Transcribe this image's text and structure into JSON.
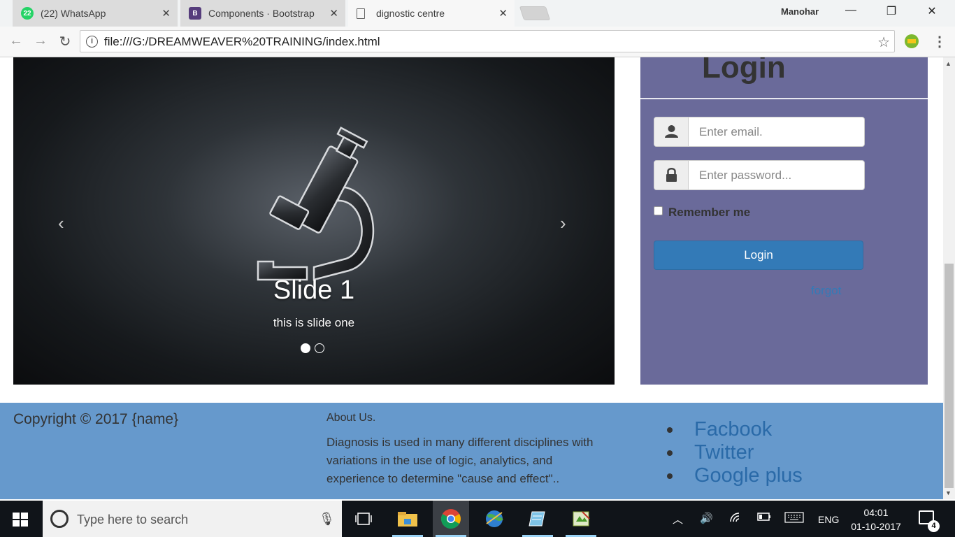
{
  "browser": {
    "user": "Manohar",
    "tabs": [
      {
        "title": "(22) WhatsApp",
        "badge": "22"
      },
      {
        "title": "Components · Bootstrap",
        "badge": "B"
      },
      {
        "title": "dignostic centre"
      }
    ],
    "url": "file:///G:/DREAMWEAVER%20TRAINING/index.html",
    "controls": {
      "minimize": "—",
      "restore": "❐",
      "close": "✕"
    }
  },
  "carousel": {
    "slide_title": "Slide 1",
    "slide_text": "this is slide one",
    "prev": "‹",
    "next": "›",
    "active_index": 0,
    "slide_count": 2
  },
  "login": {
    "title": "Login",
    "email_placeholder": "Enter email.",
    "password_placeholder": "Enter password...",
    "remember_label": "Remember me",
    "button_label": "Login",
    "forgot_label": "forgot"
  },
  "footer": {
    "copyright": "Copyright © 2017 {name}",
    "about_title": "About Us.",
    "about_text": "Diagnosis is used in many different disciplines with variations in the use of logic, analytics, and experience to determine \"cause and effect\"..",
    "social": [
      {
        "label": "Facbook"
      },
      {
        "label": "Twitter"
      },
      {
        "label": "Google plus"
      }
    ]
  },
  "taskbar": {
    "search_placeholder": "Type here to search",
    "language": "ENG",
    "time": "04:01",
    "date": "01-10-2017",
    "notification_count": "4"
  }
}
